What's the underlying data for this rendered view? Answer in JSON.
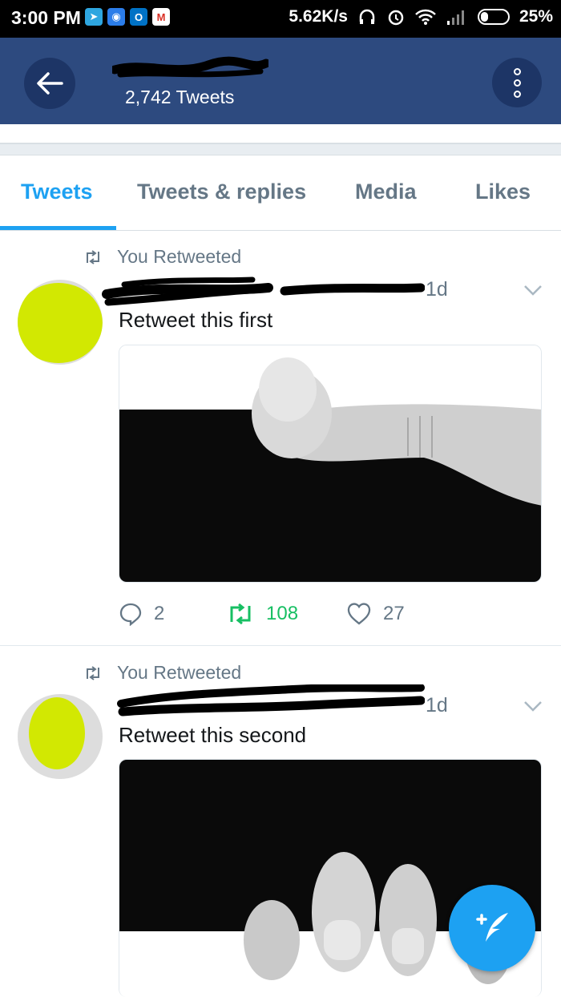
{
  "status_bar": {
    "time": "3:00 PM",
    "speed": "5.62K/s",
    "battery": "25%",
    "apps": [
      {
        "name": "telegram-icon",
        "color": "#2ea6e0",
        "glyph": "➤"
      },
      {
        "name": "message-app-icon",
        "color": "#2b7de9",
        "glyph": "◉"
      },
      {
        "name": "outlook-icon",
        "color": "#0072c6",
        "glyph": "O"
      },
      {
        "name": "gmail-icon",
        "color": "#ffffff",
        "glyph": "M"
      }
    ]
  },
  "header": {
    "tweet_count": "2,742 Tweets"
  },
  "tabs": [
    {
      "label": "Tweets",
      "active": true
    },
    {
      "label": "Tweets & replies",
      "active": false
    },
    {
      "label": "Media",
      "active": false
    },
    {
      "label": "Likes",
      "active": false
    }
  ],
  "tweets": [
    {
      "retweet_label": "You Retweeted",
      "time": "1d",
      "text": "Retweet this first",
      "replies": "2",
      "retweets": "108",
      "likes": "27"
    },
    {
      "retweet_label": "You Retweeted",
      "time": "1d",
      "text": "Retweet this second"
    }
  ],
  "colors": {
    "header_bg": "#2d4a7f",
    "accent": "#1da1f2",
    "retweet_green": "#17bf63",
    "redaction_yellow": "#d2e802"
  }
}
